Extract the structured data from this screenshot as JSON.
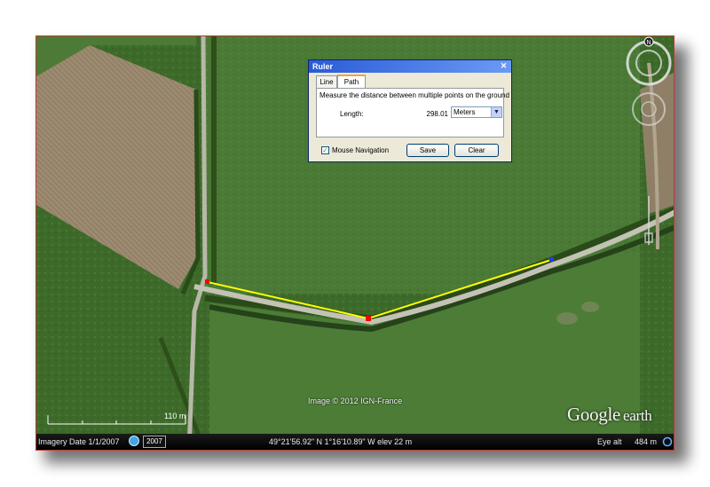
{
  "ruler": {
    "title": "Ruler",
    "close_glyph": "✕",
    "tabs": [
      {
        "label": "Line",
        "active": false
      },
      {
        "label": "Path",
        "active": true
      }
    ],
    "description": "Measure the distance between multiple points on the ground",
    "length_label": "Length:",
    "length_value": "298.01",
    "unit_selected": "Meters",
    "mouse_nav_label": "Mouse Navigation",
    "mouse_nav_checked": true,
    "save_label": "Save",
    "clear_label": "Clear"
  },
  "map": {
    "scale_label": "110 m",
    "copyright": "Image © 2012 IGN-France",
    "logo_main": "Google",
    "logo_sub": "earth",
    "north_label": "N",
    "path_color": "#ffff00",
    "point_colors": {
      "start": "#ff0000",
      "mid": "#ff0000",
      "end": "#1a3cff"
    }
  },
  "status": {
    "imagery_date": "Imagery Date  1/1/2007",
    "timeline_year": "2007",
    "coords": "49°21'56.92\" N   1°16'10.89\" W  elev   22 m",
    "eye_alt_label": "Eye alt",
    "eye_alt_value": "484 m"
  }
}
